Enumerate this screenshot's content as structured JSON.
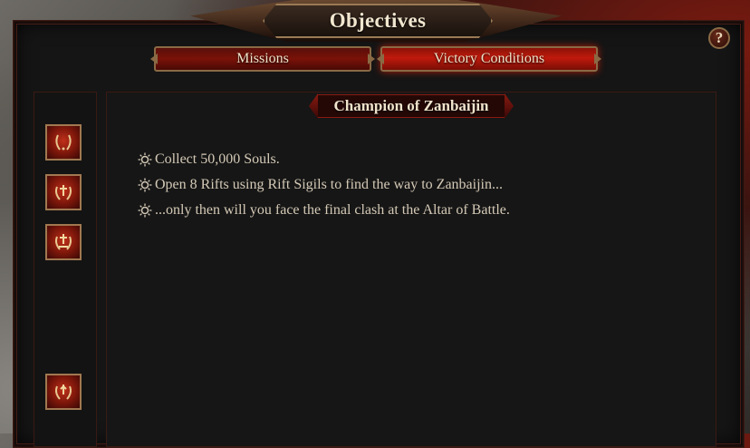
{
  "header": {
    "title": "Objectives",
    "help_label": "?"
  },
  "tabs": [
    {
      "label": "Missions",
      "active": false
    },
    {
      "label": "Victory Conditions",
      "active": true
    }
  ],
  "sidebar": {
    "icons": [
      "laurel-wreath-icon",
      "laurel-rift-icon",
      "laurel-multi-icon",
      "laurel-sigil-icon"
    ]
  },
  "panel": {
    "title": "Champion of Zanbaijin",
    "conditions": [
      {
        "text": "Collect 50,000 Souls.",
        "icon": "sun-bullet-icon"
      },
      {
        "text": "Open 8 Rifts using Rift Sigils to find the way to Zanbaijin...",
        "icon": "sun-bullet-icon"
      },
      {
        "text": "...only then will you face the final clash at the Altar of Battle.",
        "icon": "sun-bullet-icon"
      }
    ]
  },
  "colors": {
    "accent_red": "#c01a0c",
    "gold_border": "#a07850",
    "text": "#d4c9b6"
  }
}
